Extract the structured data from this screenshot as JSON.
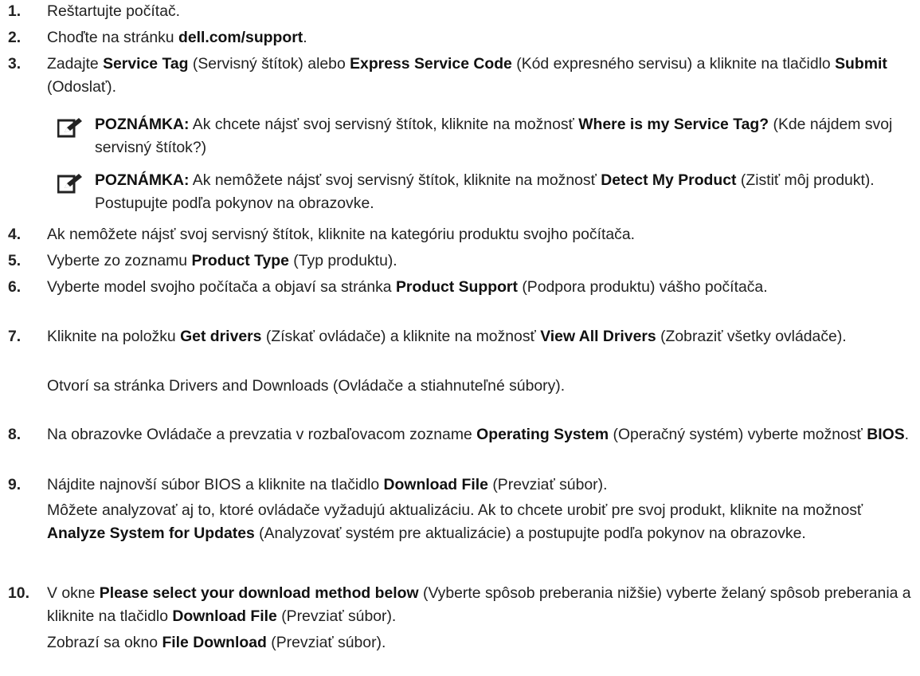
{
  "steps": {
    "s1": {
      "num": "1.",
      "text": "Reštartujte počítač."
    },
    "s2": {
      "num": "2.",
      "pre": "Choďte na stránku ",
      "b1": "dell.com/support",
      "post": "."
    },
    "s3": {
      "num": "3.",
      "pre": "Zadajte ",
      "b1": "Service Tag",
      "mid1": " (Servisný štítok) alebo ",
      "b2": "Express Service Code",
      "mid2": " (Kód expresného servisu) a kliknite na tlačidlo ",
      "b3": "Submit",
      "post": " (Odoslať)."
    },
    "s4": {
      "num": "4.",
      "text": "Ak nemôžete nájsť svoj servisný štítok, kliknite na kategóriu produktu svojho počítača."
    },
    "s5": {
      "num": "5.",
      "pre": "Vyberte zo zoznamu ",
      "b1": "Product Type",
      "post": " (Typ produktu)."
    },
    "s6": {
      "num": "6.",
      "pre": "Vyberte model svojho počítača a objaví sa stránka ",
      "b1": "Product Support",
      "post": " (Podpora produktu) vášho počítača."
    },
    "s7": {
      "num": "7.",
      "pre": "Kliknite na položku ",
      "b1": "Get drivers",
      "mid1": " (Získať ovládače) a kliknite na možnosť ",
      "b2": "View All Drivers",
      "post": " (Zobraziť všetky ovládače).",
      "sub": "Otvorí sa stránka Drivers and Downloads (Ovládače a stiahnuteľné súbory)."
    },
    "s8": {
      "num": "8.",
      "pre": "Na obrazovke Ovládače a prevzatia v rozbaľovacom zozname ",
      "b1": "Operating System",
      "mid1": " (Operačný systém) vyberte možnosť ",
      "b2": "BIOS",
      "post": "."
    },
    "s9": {
      "num": "9.",
      "pre": "Nájdite najnovší súbor BIOS a kliknite na tlačidlo ",
      "b1": "Download File",
      "post": " (Prevziať súbor).",
      "sub_pre": "Môžete analyzovať aj to, ktoré ovládače vyžadujú aktualizáciu. Ak to chcete urobiť pre svoj produkt, kliknite na možnosť ",
      "sub_b1": "Analyze System for Updates",
      "sub_post": " (Analyzovať systém pre aktualizácie) a postupujte podľa pokynov na obrazovke."
    },
    "s10": {
      "num": "10.",
      "pre": "V okne ",
      "b1": "Please select your download method below",
      "mid1": " (Vyberte spôsob preberania nižšie) vyberte želaný spôsob preberania a kliknite na tlačidlo ",
      "b2": "Download File",
      "post": " (Prevziať súbor).",
      "sub_pre": "Zobrazí sa okno ",
      "sub_b1": "File Download",
      "sub_post": " (Prevziať súbor)."
    }
  },
  "notes": {
    "n1": {
      "label": "POZNÁMKA:",
      "pre": " Ak chcete nájsť svoj servisný štítok, kliknite na možnosť ",
      "b1": "Where is my Service Tag?",
      "post": " (Kde nájdem svoj servisný štítok?)"
    },
    "n2": {
      "label": "POZNÁMKA:",
      "pre": " Ak nemôžete nájsť svoj servisný štítok, kliknite na možnosť ",
      "b1": "Detect My Product",
      "post": " (Zistiť môj produkt). Postupujte podľa pokynov na obrazovke."
    }
  },
  "icons": {
    "note": "note-pencil-icon"
  }
}
